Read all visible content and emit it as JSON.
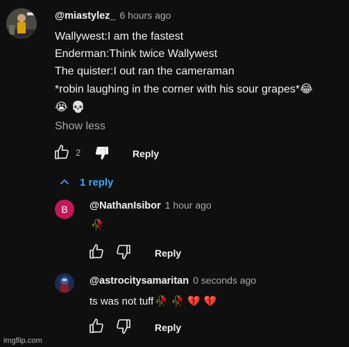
{
  "main_comment": {
    "author": "@miastylez_",
    "time": "6 hours ago",
    "lines": [
      "Wallywest:I am the fastest",
      "Enderman:Think twice Wallywest",
      "The quister:I out ran the cameraman",
      "*robin laughing in the corner with his sour grapes*"
    ],
    "line4_emoji": "😂",
    "line5_emoji": "😭 💀",
    "show_less_label": "Show less",
    "like_count": "2",
    "reply_label": "Reply",
    "like_icon": "thumbs-up-icon",
    "dislike_icon": "thumbs-down-icon"
  },
  "replies_toggle": {
    "label": "1 reply",
    "icon": "chevron-up-icon",
    "color": "#3ea6ff"
  },
  "replies": [
    {
      "author": "@NathanIsibor",
      "time": "1 hour ago",
      "avatar_letter": "B",
      "avatar_color": "#c2185b",
      "text": "🥀",
      "reply_label": "Reply"
    },
    {
      "author": "@astrocitysamaritan",
      "time": "0 seconds ago",
      "text": "ts was not tuff",
      "text_emoji": "🥀 🥀 💔 💔",
      "reply_label": "Reply"
    }
  ],
  "watermark": "imgflip.com"
}
